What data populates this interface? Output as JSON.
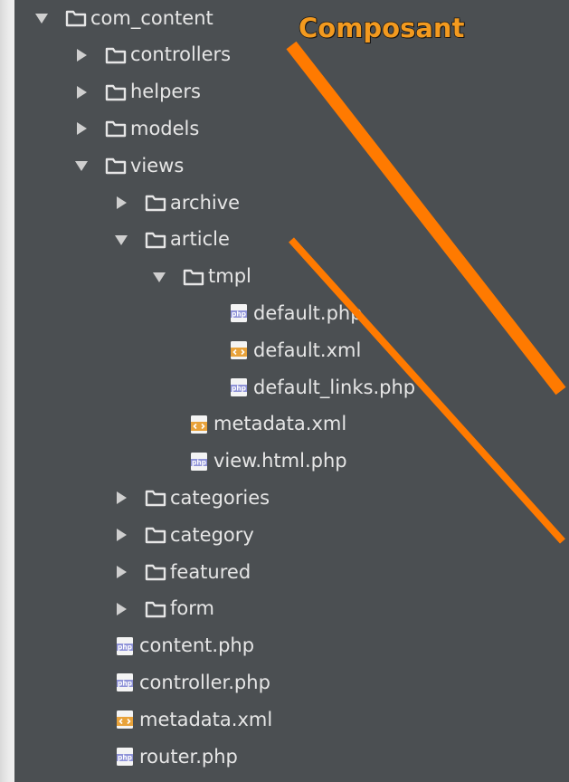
{
  "annotation": "Composant",
  "tree": [
    {
      "label": "com_content",
      "type": "folder",
      "state": "expanded",
      "level": 0
    },
    {
      "label": "controllers",
      "type": "folder",
      "state": "collapsed",
      "level": 1
    },
    {
      "label": "helpers",
      "type": "folder",
      "state": "collapsed",
      "level": 1
    },
    {
      "label": "models",
      "type": "folder",
      "state": "collapsed",
      "level": 1
    },
    {
      "label": "views",
      "type": "folder",
      "state": "expanded",
      "level": 1
    },
    {
      "label": "archive",
      "type": "folder",
      "state": "collapsed",
      "level": 2
    },
    {
      "label": "article",
      "type": "folder",
      "state": "expanded",
      "level": 2
    },
    {
      "label": "tmpl",
      "type": "folder",
      "state": "expanded",
      "level": 3
    },
    {
      "label": "default.php",
      "type": "php",
      "level": 4
    },
    {
      "label": "default.xml",
      "type": "xml",
      "level": 4
    },
    {
      "label": "default_links.php",
      "type": "php",
      "level": 4
    },
    {
      "label": "metadata.xml",
      "type": "xml",
      "level": 3
    },
    {
      "label": "view.html.php",
      "type": "php",
      "level": 3
    },
    {
      "label": "categories",
      "type": "folder",
      "state": "collapsed",
      "level": 2
    },
    {
      "label": "category",
      "type": "folder",
      "state": "collapsed",
      "level": 2
    },
    {
      "label": "featured",
      "type": "folder",
      "state": "collapsed",
      "level": 2
    },
    {
      "label": "form",
      "type": "folder",
      "state": "collapsed",
      "level": 2
    },
    {
      "label": "content.php",
      "type": "php",
      "level": 2
    },
    {
      "label": "controller.php",
      "type": "php",
      "level": 2
    },
    {
      "label": "metadata.xml",
      "type": "xml",
      "level": 2
    },
    {
      "label": "router.php",
      "type": "php",
      "level": 2
    }
  ],
  "colors": {
    "panel": "#4b4f52",
    "text": "#e6e6e6",
    "annotation": "#f39a1f",
    "php_icon": "#8f93d8",
    "xml_icon": "#e8a23a"
  }
}
